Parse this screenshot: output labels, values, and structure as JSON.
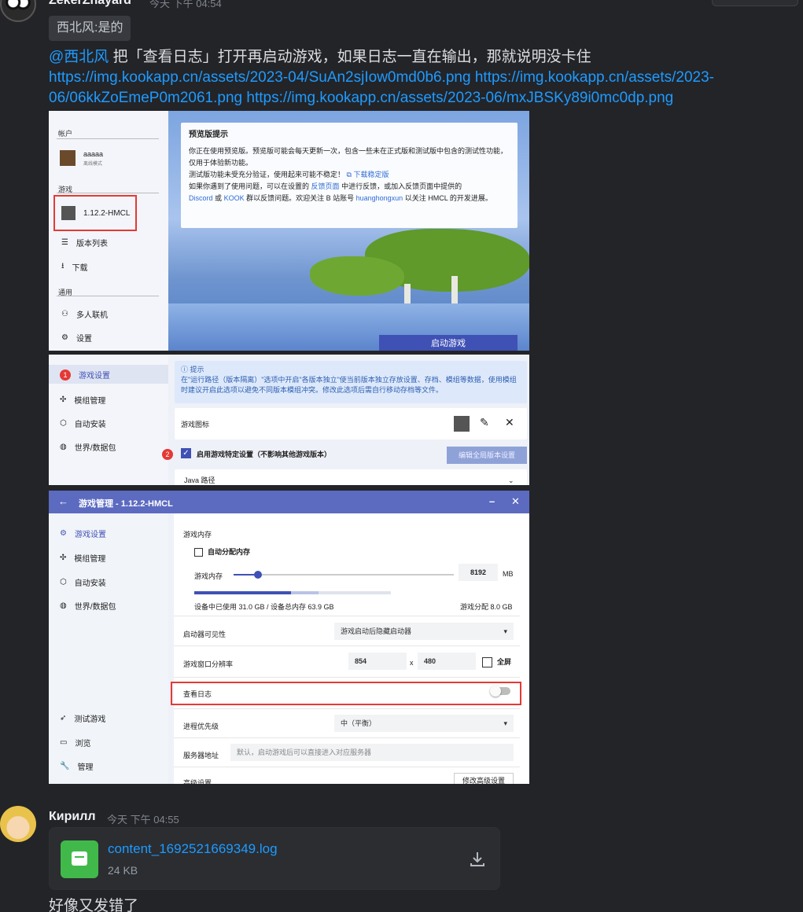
{
  "message1": {
    "author": "ZekerZhayard",
    "time": "今天 下午 04:54",
    "reply_quote": "西北风:是的",
    "mention": "@西北风",
    "text": " 把「查看日志」打开再启动游戏，如果日志一直在输出，那就说明没卡住 ",
    "links": [
      "https://img.kookapp.cn/assets/2023-04/SuAn2sjIow0md0b6.png",
      "https://img.kookapp.cn/assets/2023-06/06kkZoEmeP0m2061.png",
      "https://img.kookapp.cn/assets/2023-06/mxJBSKy89i0mc0dp.png"
    ]
  },
  "shot1": {
    "section_account": "帐户",
    "user_name": "aaaaa",
    "user_mode": "离线模式",
    "section_game": "游戏",
    "game_version": "1.12.2-HMCL",
    "version_list": "版本列表",
    "download": "下载",
    "section_general": "通用",
    "multiplayer": "多人联机",
    "settings": "设置",
    "notice_title": "预览版提示",
    "notice_l1": "你正在使用预览版。预览版可能会每天更新一次，包含一些未在正式版和测试版中包含的测试性功能，仅用于体验新功能。",
    "notice_l2": "测试版功能未受充分验证，使用起来可能不稳定！",
    "notice_l2_link": "下载稳定版",
    "notice_l3a": "如果你遇到了使用问题，可以在设置的",
    "notice_l3_link": "反馈页面",
    "notice_l3b": "中进行反馈，或加入反馈页面中提供的",
    "notice_discord": "Discord",
    "notice_or": "或",
    "notice_kook": "KOOK",
    "notice_l4a": "群以反馈问题。欢迎关注 B 站账号",
    "notice_bili": "huanghongxun",
    "notice_l4b": "以关注 HMCL 的开发进展。",
    "launch_button": "启动游戏"
  },
  "shot2": {
    "badge1": "1",
    "badge2": "2",
    "tab_game_settings": "游戏设置",
    "tab_mods": "模组管理",
    "tab_auto_install": "自动安装",
    "tab_worlds": "世界/数据包",
    "tip_title": "提示",
    "tip_text": "在\"运行路径（版本隔离）\"选项中开启\"各版本独立\"使当前版本独立存放设置、存档、模组等数据，使用模组时建议开启此选项以避免不同版本模组冲突。修改此选项后需自行移动存档等文件。",
    "game_icon": "游戏图标",
    "special_settings": "启用游戏特定设置（不影响其他游戏版本）",
    "edit_global": "编辑全局版本设置",
    "java_path": "Java 路径"
  },
  "shot3": {
    "title": "游戏管理 - 1.12.2-HMCL",
    "tab_game_settings": "游戏设置",
    "tab_mods": "模组管理",
    "tab_auto_install": "自动安装",
    "tab_worlds": "世界/数据包",
    "tab_test_game": "测试游戏",
    "tab_browse": "浏览",
    "tab_manage": "管理",
    "memory_title": "游戏内存",
    "auto_memory": "自动分配内存",
    "memory_label": "游戏内存",
    "memory_value": "8192",
    "memory_unit": "MB",
    "memory_slider_fraction": 0.11,
    "memory_used_fraction": 0.49,
    "memory_allocated_fraction": 0.63,
    "device_usage": "设备中已使用 31.0 GB / 设备总内存 63.9 GB",
    "game_alloc": "游戏分配 8.0 GB",
    "launcher_visibility": "启动器可见性",
    "launcher_visibility_value": "游戏启动后隐藏启动器",
    "window_resolution": "游戏窗口分辨率",
    "res_w": "854",
    "res_x": "x",
    "res_h": "480",
    "fullscreen": "全屏",
    "view_log": "查看日志",
    "process_priority": "进程优先级",
    "priority_value": "中（平衡）",
    "server_address": "服务器地址",
    "server_placeholder": "默认，启动游戏后可以直接进入对应服务器",
    "advanced": "高级设置",
    "advanced_btn": "修改高级设置"
  },
  "message2": {
    "author": "Кирилл",
    "time": "今天 下午 04:55",
    "file_name": "content_1692521669349.log",
    "file_size": "24 KB",
    "text": "好像又发错了"
  }
}
